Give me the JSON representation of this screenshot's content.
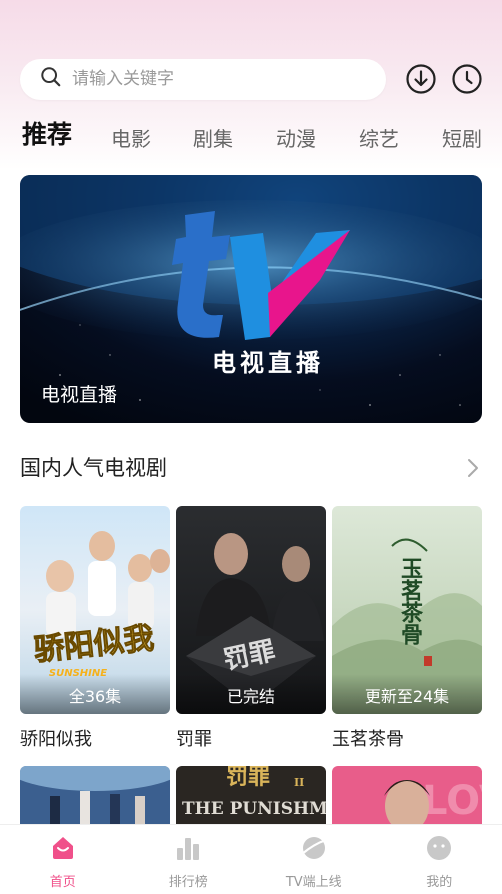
{
  "search": {
    "placeholder": "请输入关键字"
  },
  "header_icons": [
    "download-icon",
    "history-icon"
  ],
  "tabs": [
    {
      "label": "推荐",
      "active": true
    },
    {
      "label": "电影"
    },
    {
      "label": "剧集"
    },
    {
      "label": "动漫"
    },
    {
      "label": "综艺"
    },
    {
      "label": "短剧"
    }
  ],
  "banner": {
    "logo_text": "电视直播",
    "caption": "电视直播"
  },
  "section": {
    "title": "国内人气电视剧"
  },
  "cards": [
    {
      "title": "骄阳似我",
      "badge": "全36集",
      "poster_text": "骄阳似我",
      "poster_sub": "SUNSHINE"
    },
    {
      "title": "罚罪",
      "badge": "已完结",
      "poster_text": "罚罪"
    },
    {
      "title": "玉茗茶骨",
      "badge": "更新至24集",
      "poster_text": "玉茗茶骨"
    }
  ],
  "row2_posters": [
    {
      "name": "poster-fantasy"
    },
    {
      "name": "poster-punishment-2",
      "text_top": "罚罪",
      "text_en": "THE PUNISHMENT",
      "numeral": "II"
    },
    {
      "name": "poster-pink",
      "text": "LOVE"
    }
  ],
  "bottom_nav": [
    {
      "label": "首页",
      "active": true
    },
    {
      "label": "排行榜"
    },
    {
      "label": "TV端上线"
    },
    {
      "label": "我的"
    }
  ],
  "colors": {
    "accent": "#f0508a",
    "nav_inactive": "#c8c8c8",
    "tv_blue": "#1f8fe0",
    "tv_magenta": "#e8158c"
  }
}
